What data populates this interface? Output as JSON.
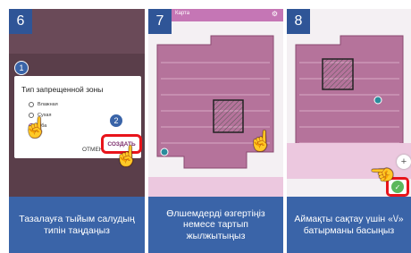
{
  "panels": [
    {
      "step": "6",
      "dialog": {
        "title": "Тип запрещенной зоны",
        "options": [
          "Влажная",
          "Сухая",
          "Оба"
        ],
        "selected": "Оба",
        "cancel_label": "ОТМЕНА",
        "create_label": "СОЗДАТЬ"
      },
      "markers": [
        "1",
        "2"
      ],
      "caption": "Тазалауға тыйым салудың типін таңдаңыз"
    },
    {
      "step": "7",
      "app_title": "Карта",
      "caption": "Өлшемдерді өзгертіңіз немесе тартып жылжытыңыз"
    },
    {
      "step": "8",
      "plus_label": "+",
      "check_label": "✓",
      "caption": "Аймақты сақтау үшін «\\/» батырманы басыңыз"
    }
  ],
  "colors": {
    "caption_bg": "#3a64a8",
    "map_fill": "#b5739b",
    "accent": "#c576b5",
    "highlight": "#e8141b"
  }
}
